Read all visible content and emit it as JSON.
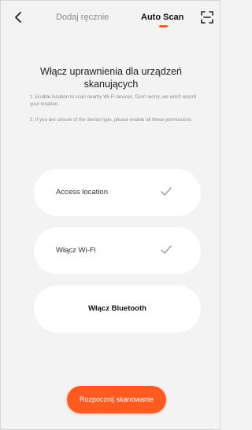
{
  "header": {
    "back_icon": "chevron-left-icon",
    "tabs": [
      {
        "label": "Dodaj ręcznie",
        "active": false
      },
      {
        "label": "Auto Scan",
        "active": true
      }
    ],
    "scan_icon": "scan-frame-icon"
  },
  "main": {
    "title": "Włącz uprawnienia dla urządzeń skanujących",
    "instructions": [
      "1. Enable location to scan nearby Wi-Fi devices. Don't worry, we won't record your location.",
      "2. If you are unsure of the device type, please enable all these permissions"
    ],
    "permissions": [
      {
        "label": "Access location",
        "granted": true
      },
      {
        "label": "Włącz Wi-Fi",
        "granted": true
      },
      {
        "label": "Włącz Bluetooth",
        "granted": false
      }
    ],
    "start_button": "Rozpocznij skanowanie"
  },
  "colors": {
    "accent": "#ff5a1f",
    "background": "#f3f3f3",
    "card": "#ffffff",
    "check": "#9a9a9a"
  }
}
